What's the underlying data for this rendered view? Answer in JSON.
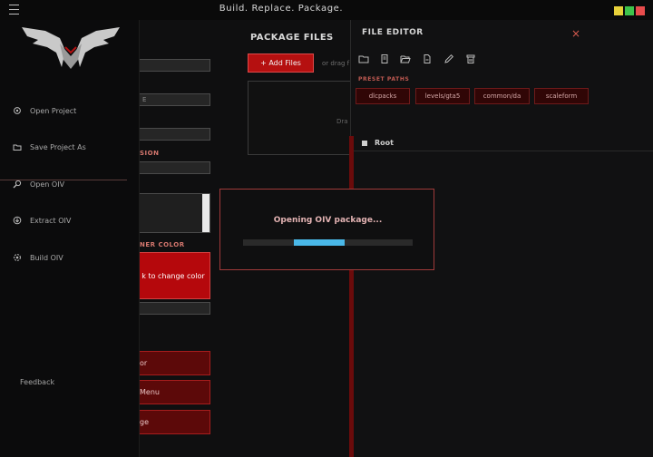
{
  "app": {
    "title": "Build. Replace. Package."
  },
  "colors": {
    "accent": "#b51010",
    "progress": "#4ab8e8",
    "close": "#d65a4f",
    "win_yellow": "#e8d13a",
    "win_green": "#3ec34b",
    "win_red": "#e84c4c"
  },
  "sidebar": {
    "items": [
      {
        "label": "Open Project",
        "icon": "gear-icon"
      },
      {
        "label": "Save Project As",
        "icon": "folder-icon"
      },
      {
        "label": "Open OIV",
        "icon": "search-icon"
      },
      {
        "label": "Extract OIV",
        "icon": "extract-icon"
      },
      {
        "label": "Build OIV",
        "icon": "build-icon"
      }
    ],
    "feedback": "Feedback"
  },
  "left_panel": {
    "field_partial": "E",
    "version_label": "SION",
    "banner_color_label": "NER COLOR",
    "change_color_label": "k to change color",
    "buttons": [
      "or",
      "Menu",
      "ge"
    ]
  },
  "package_files": {
    "title": "PACKAGE FILES",
    "add_label": "+ Add Files",
    "drag_hint": "or drag f",
    "drop_hint": "Dra"
  },
  "file_editor": {
    "title": "FILE EDITOR",
    "close": "×",
    "tools": [
      "new-folder-icon",
      "file-icon",
      "open-folder-icon",
      "document-icon",
      "edit-icon",
      "delete-icon"
    ],
    "preset_label": "PRESET PATHS",
    "presets": [
      "dlcpacks",
      "levels/gta5",
      "common/da",
      "scaleform"
    ],
    "root_label": "Root"
  },
  "modal": {
    "message": "Opening OIV package...",
    "progress": 0.3
  }
}
